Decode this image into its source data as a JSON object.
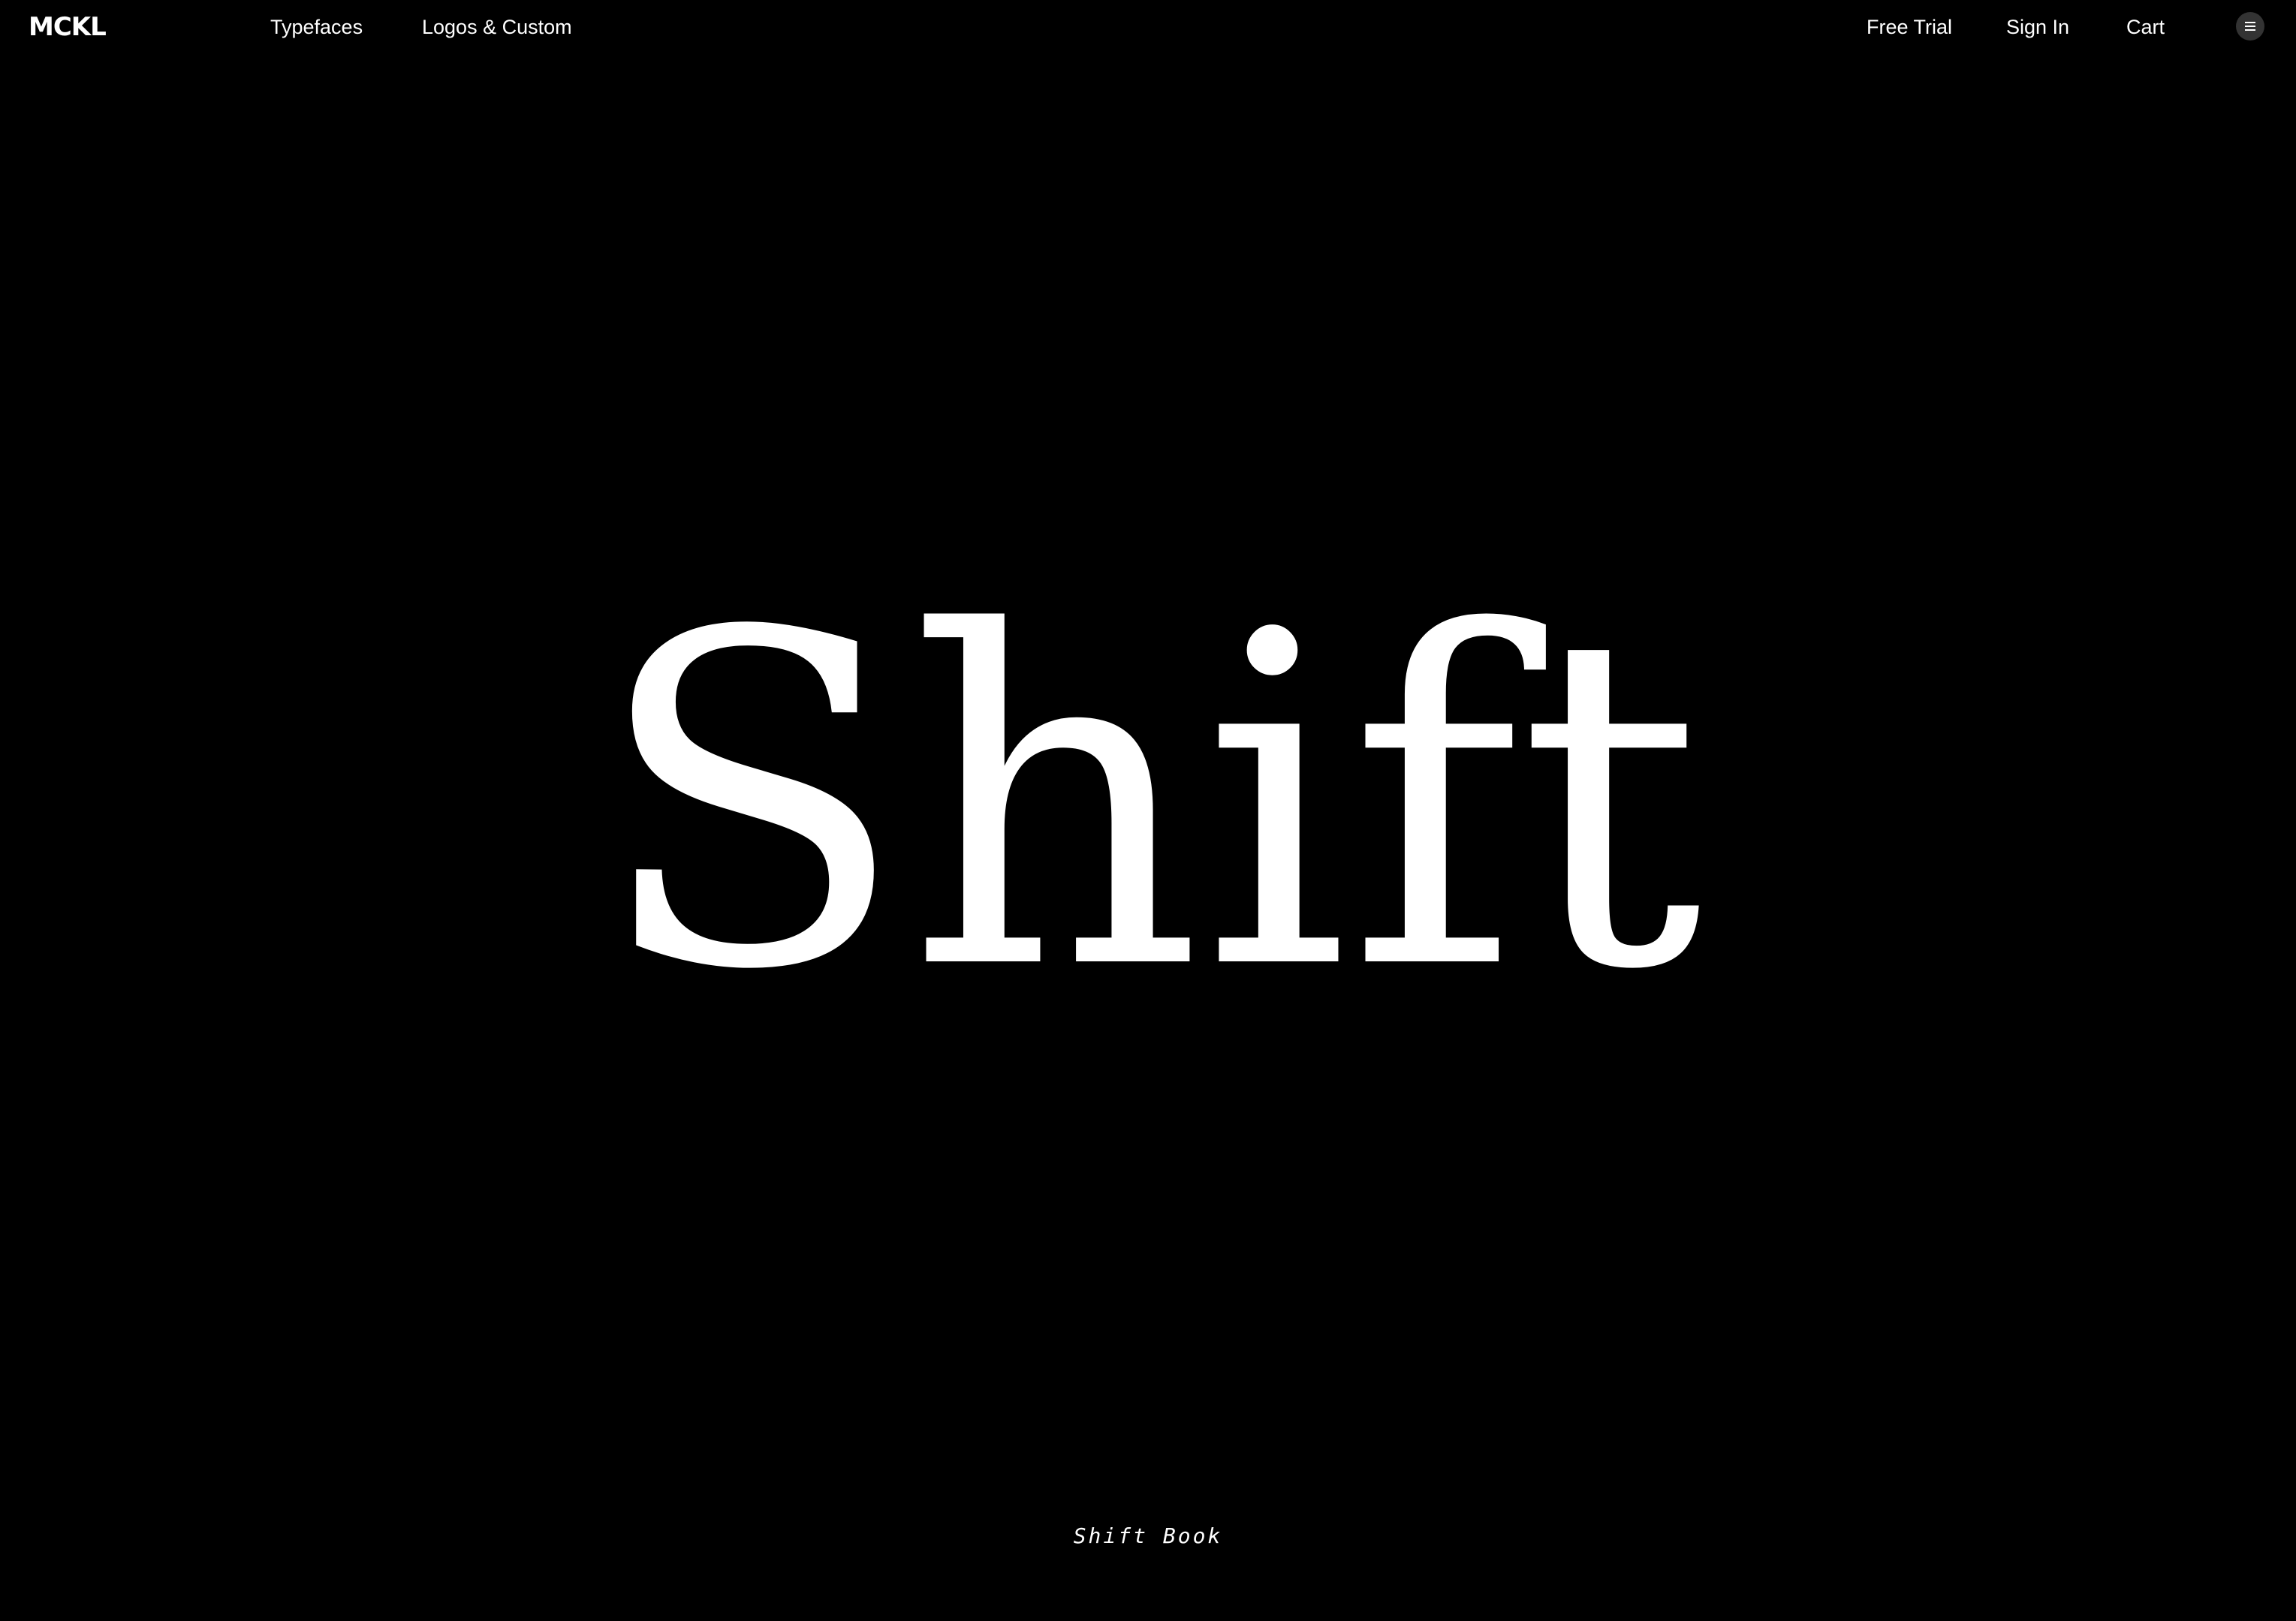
{
  "nav": {
    "logo": "MCKL",
    "left_links": [
      {
        "label": "Typefaces"
      },
      {
        "label": "Logos & Custom"
      }
    ],
    "right_links": [
      {
        "label": "Free Trial"
      },
      {
        "label": "Sign In"
      },
      {
        "label": "Cart"
      }
    ],
    "menu_icon": "hamburger-menu-icon"
  },
  "hero": {
    "specimen": "Shift",
    "caption": "Shift Book"
  },
  "colors": {
    "background": "#000000",
    "text": "#ffffff",
    "menu_button": "#333333"
  }
}
